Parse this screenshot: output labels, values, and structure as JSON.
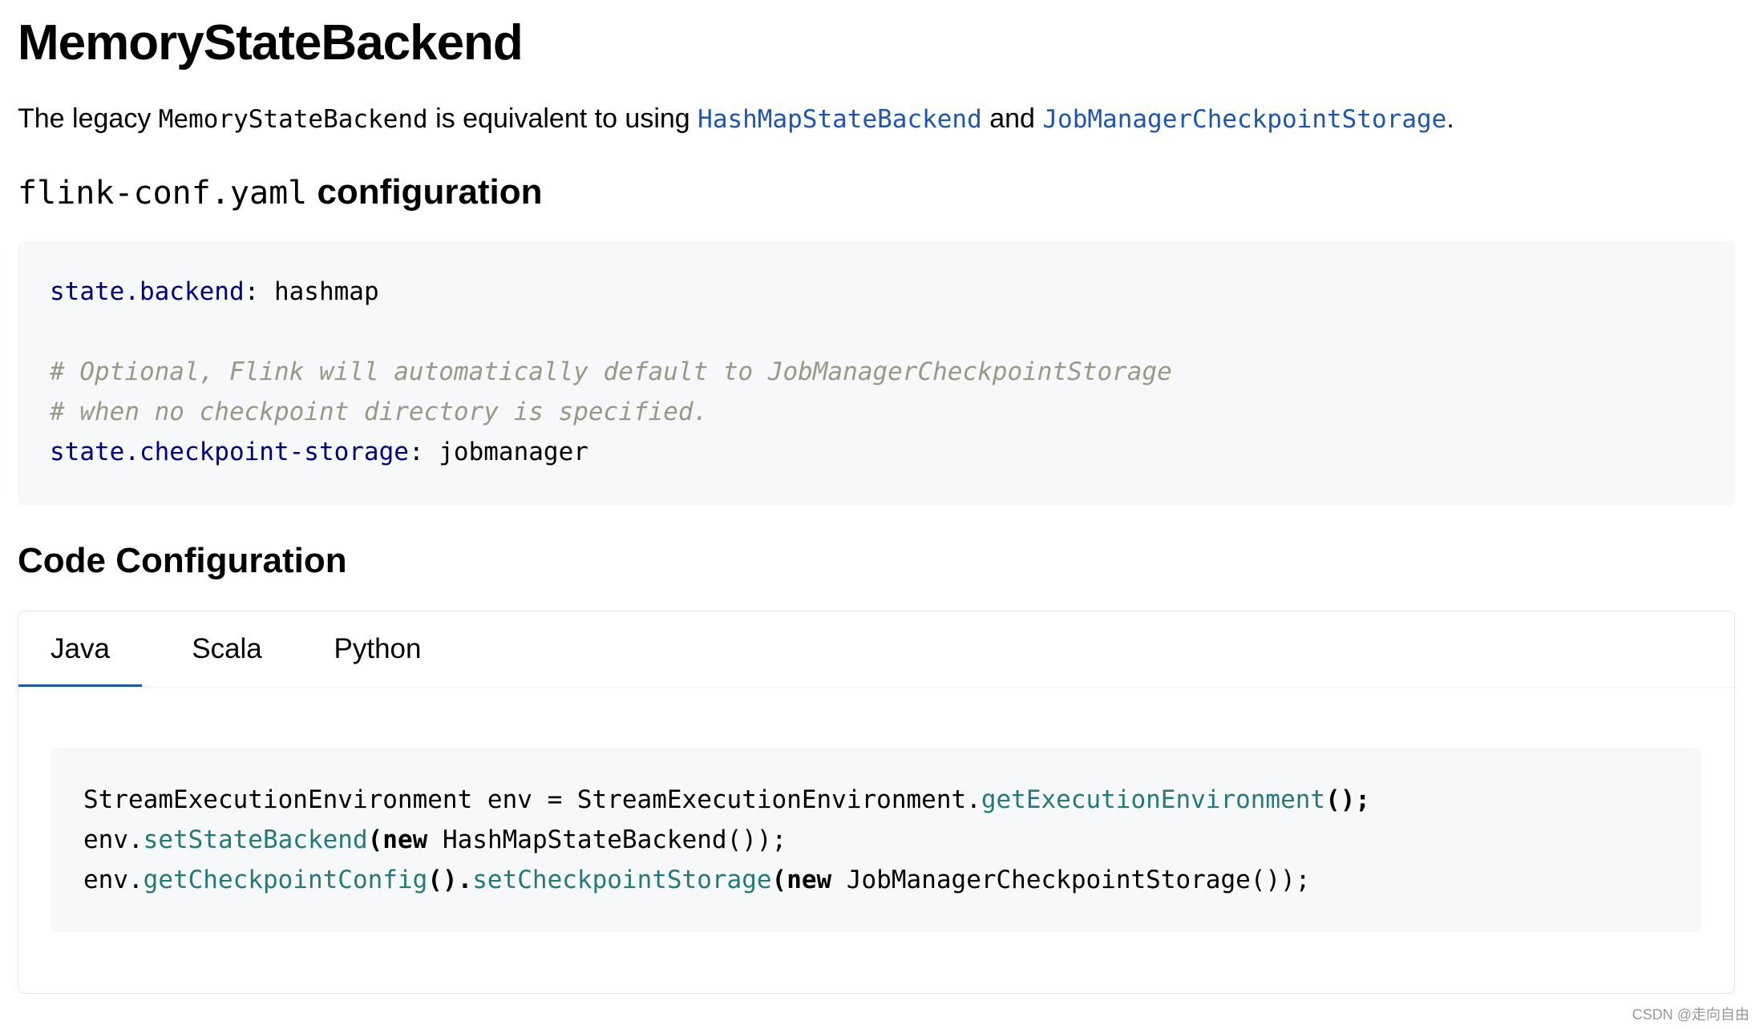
{
  "heading": "MemoryStateBackend",
  "intro": {
    "pre": "The legacy ",
    "class_name": "MemoryStateBackend",
    "mid": " is equivalent to using ",
    "link1": "HashMapStateBackend",
    "and": " and ",
    "link2": "JobManagerCheckpointStorage",
    "end": "."
  },
  "yaml_section": {
    "file": "flink-conf.yaml",
    "word": " configuration",
    "lines": {
      "l1_key": "state.backend",
      "l1_val": ": hashmap",
      "c1": "# Optional, Flink will automatically default to JobManagerCheckpointStorage",
      "c2": "# when no checkpoint directory is specified.",
      "l2_key": "state.checkpoint-storage",
      "l2_val": ": jobmanager"
    }
  },
  "code_section": {
    "title": "Code Configuration",
    "tabs": [
      "Java",
      "Scala",
      "Python"
    ],
    "active_tab": "Java",
    "java": {
      "line1_a": "StreamExecutionEnvironment env = StreamExecutionEnvironment.",
      "line1_fn": "getExecutionEnvironment",
      "line1_b": "();",
      "line2_a": "env.",
      "line2_fn": "setStateBackend",
      "line2_b": "(",
      "line2_kw": "new",
      "line2_c": " HashMapStateBackend());",
      "line3_a": "env.",
      "line3_fn1": "getCheckpointConfig",
      "line3_b": "().",
      "line3_fn2": "setCheckpointStorage",
      "line3_c": "(",
      "line3_kw": "new",
      "line3_d": " JobManagerCheckpointStorage());"
    }
  },
  "watermark": "CSDN @走向自由"
}
